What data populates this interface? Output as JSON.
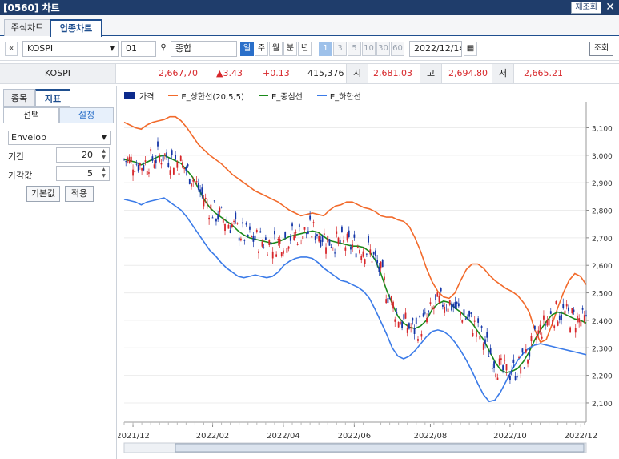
{
  "window": {
    "title": "[0560] 차트",
    "reinquire_label": "재조회",
    "close_glyph": "✕"
  },
  "top_tabs": [
    {
      "label": "주식차트",
      "active": false
    },
    {
      "label": "업종차트",
      "active": true
    }
  ],
  "toolbar": {
    "collapse_glyph": "«",
    "market_select": "KOSPI",
    "code": "01",
    "search_glyph": "⚲",
    "name": "종합",
    "periods": [
      "일",
      "주",
      "월",
      "분",
      "년"
    ],
    "active_period": "일",
    "intervals": [
      "1",
      "3",
      "5",
      "10",
      "30",
      "60"
    ],
    "date": "2022/12/14",
    "calendar_glyph": "▦",
    "query_label": "조회"
  },
  "quote": {
    "index_name": "KOSPI",
    "price": "2,667,70",
    "change": "▲3.43",
    "rate": "+0.13",
    "volume": "415,376",
    "open_label": "시",
    "open": "2,681.03",
    "high_label": "고",
    "high": "2,694.80",
    "low_label": "저",
    "low": "2,665.21"
  },
  "left_panel": {
    "tabs": [
      "종목",
      "지표"
    ],
    "active_tab": "지표",
    "segments": [
      "선택",
      "설정"
    ],
    "active_segment": "설정",
    "indicator": "Envelop",
    "period_label": "기간",
    "period_value": "20",
    "rate_label": "가감값",
    "rate_value": "5",
    "default_button": "기본값",
    "apply_button": "적용"
  },
  "chart_data": {
    "type": "line",
    "legend": [
      {
        "name": "가격",
        "color": "#0c2a8c",
        "kind": "box"
      },
      {
        "name": "E_상한선(20,5,5)",
        "color": "#f26a2b",
        "kind": "line"
      },
      {
        "name": "E_중심선",
        "color": "#1a8a1a",
        "kind": "line"
      },
      {
        "name": "E_하한선",
        "color": "#3b7be8",
        "kind": "line"
      }
    ],
    "ylim": [
      2030,
      3180
    ],
    "y_ticks": [
      3100,
      3000,
      2900,
      2800,
      2700,
      2600,
      2500,
      2400,
      2300,
      2200,
      2100
    ],
    "y_tick_labels": [
      "3,100",
      "3,000",
      "2,900",
      "2,800",
      "2,700",
      "2,600",
      "2,500",
      "2,400",
      "2,300",
      "2,200",
      "2,100"
    ],
    "x_tick_labels": [
      "2021/12",
      "2022/02",
      "2022/04",
      "2022/06",
      "2022/08",
      "2022/10",
      "2022/12"
    ],
    "x_tick_idx": [
      5,
      50,
      90,
      130,
      173,
      218,
      258
    ],
    "series": [
      {
        "name": "E_상한선(20,5,5)",
        "color": "#f26a2b",
        "values": [
          3120,
          3110,
          3100,
          3095,
          3110,
          3120,
          3125,
          3130,
          3140,
          3140,
          3125,
          3100,
          3070,
          3040,
          3020,
          3000,
          2985,
          2970,
          2950,
          2930,
          2915,
          2900,
          2885,
          2870,
          2860,
          2850,
          2840,
          2830,
          2815,
          2800,
          2790,
          2780,
          2785,
          2790,
          2785,
          2780,
          2800,
          2815,
          2820,
          2830,
          2830,
          2820,
          2810,
          2805,
          2795,
          2780,
          2775,
          2775,
          2765,
          2760,
          2740,
          2700,
          2650,
          2590,
          2540,
          2505,
          2485,
          2480,
          2500,
          2545,
          2585,
          2605,
          2605,
          2590,
          2565,
          2545,
          2530,
          2515,
          2505,
          2490,
          2465,
          2430,
          2365,
          2320,
          2330,
          2385,
          2445,
          2500,
          2545,
          2570,
          2560,
          2530
        ]
      },
      {
        "name": "E_중심선",
        "color": "#1a8a1a",
        "values": [
          2985,
          2980,
          2975,
          2965,
          2975,
          2985,
          2995,
          3000,
          2990,
          2980,
          2970,
          2945,
          2920,
          2880,
          2840,
          2810,
          2790,
          2775,
          2760,
          2745,
          2725,
          2710,
          2700,
          2695,
          2690,
          2685,
          2680,
          2685,
          2695,
          2705,
          2710,
          2715,
          2720,
          2725,
          2720,
          2705,
          2690,
          2685,
          2680,
          2675,
          2670,
          2670,
          2665,
          2650,
          2620,
          2570,
          2510,
          2460,
          2415,
          2390,
          2375,
          2370,
          2380,
          2400,
          2440,
          2460,
          2470,
          2465,
          2445,
          2430,
          2410,
          2390,
          2360,
          2330,
          2290,
          2250,
          2220,
          2210,
          2215,
          2225,
          2250,
          2285,
          2330,
          2365,
          2395,
          2420,
          2430,
          2425,
          2415,
          2405,
          2400,
          2390
        ]
      },
      {
        "name": "E_하한선",
        "color": "#3b7be8",
        "values": [
          2840,
          2835,
          2830,
          2820,
          2830,
          2835,
          2840,
          2845,
          2830,
          2815,
          2800,
          2775,
          2745,
          2715,
          2685,
          2655,
          2635,
          2610,
          2590,
          2575,
          2560,
          2555,
          2560,
          2565,
          2560,
          2555,
          2560,
          2575,
          2600,
          2615,
          2625,
          2630,
          2630,
          2625,
          2610,
          2590,
          2575,
          2560,
          2545,
          2540,
          2530,
          2520,
          2505,
          2480,
          2440,
          2395,
          2350,
          2300,
          2270,
          2260,
          2270,
          2290,
          2315,
          2340,
          2360,
          2365,
          2360,
          2345,
          2320,
          2290,
          2255,
          2215,
          2170,
          2130,
          2105,
          2110,
          2140,
          2180,
          2220,
          2255,
          2280,
          2300,
          2310,
          2315,
          2310,
          2305,
          2300,
          2295,
          2290,
          2285,
          2280,
          2275
        ]
      }
    ]
  }
}
